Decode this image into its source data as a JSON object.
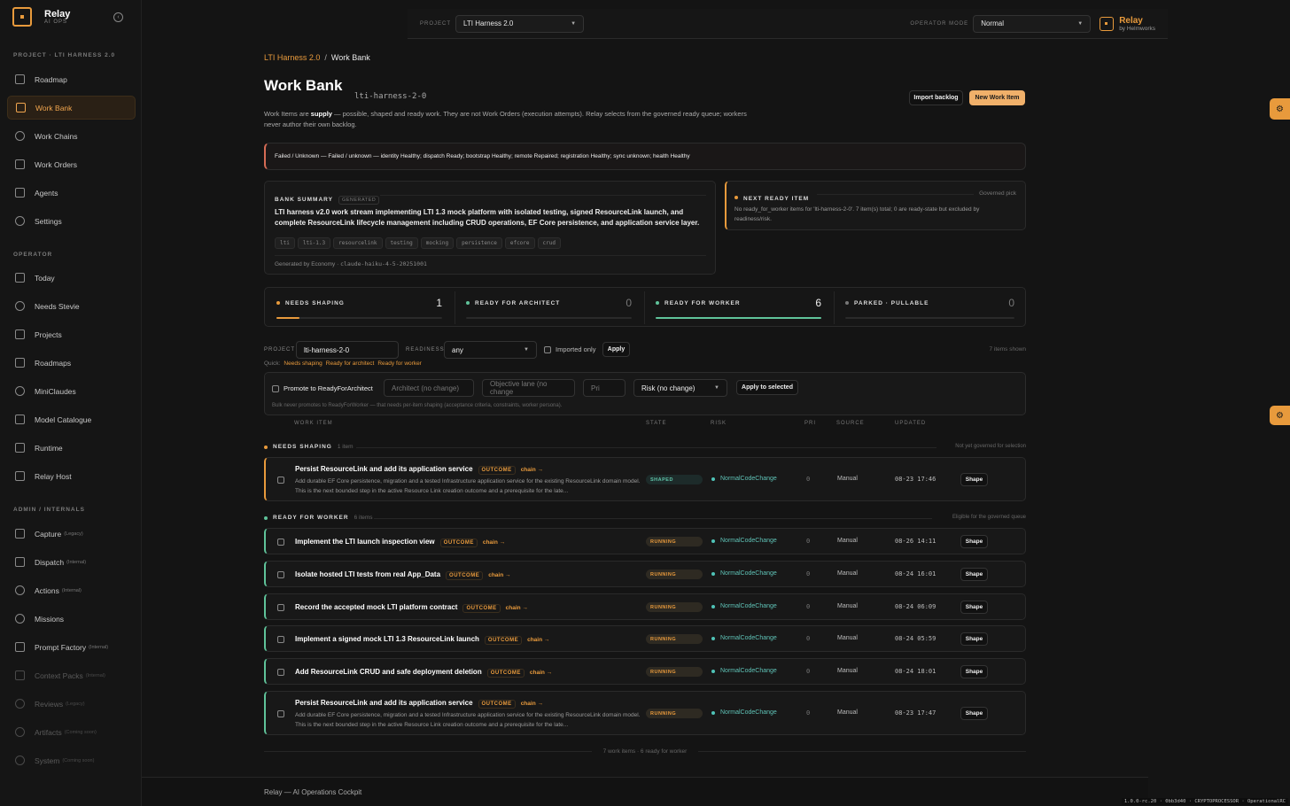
{
  "app": {
    "name": "Relay",
    "sub": "AI OPS"
  },
  "sidebar": {
    "project_section": "PROJECT · LTI HARNESS 2.0",
    "project_items": [
      {
        "label": "Roadmap"
      },
      {
        "label": "Work Bank"
      },
      {
        "label": "Work Chains"
      },
      {
        "label": "Work Orders"
      },
      {
        "label": "Agents"
      },
      {
        "label": "Settings"
      }
    ],
    "operator_section": "OPERATOR",
    "operator_items": [
      {
        "label": "Today"
      },
      {
        "label": "Needs Stevie"
      },
      {
        "label": "Projects"
      },
      {
        "label": "Roadmaps"
      },
      {
        "label": "MiniClaudes"
      },
      {
        "label": "Model Catalogue"
      },
      {
        "label": "Runtime"
      },
      {
        "label": "Relay Host"
      }
    ],
    "admin_section": "ADMIN / INTERNALS",
    "admin_items": [
      {
        "label": "Capture",
        "tag": "(Legacy)"
      },
      {
        "label": "Dispatch",
        "tag": "(Internal)"
      },
      {
        "label": "Actions",
        "tag": "(Internal)"
      },
      {
        "label": "Missions",
        "tag": ""
      },
      {
        "label": "Prompt Factory",
        "tag": "(Internal)"
      },
      {
        "label": "Context Packs",
        "tag": "(Internal)"
      },
      {
        "label": "Reviews",
        "tag": "(Legacy)"
      },
      {
        "label": "Artifacts",
        "tag": "(Coming soon)"
      },
      {
        "label": "System",
        "tag": "(Coming soon)"
      }
    ]
  },
  "topbar": {
    "project_label": "PROJECT",
    "project_value": "LTI Harness 2.0",
    "mode_label": "OPERATOR MODE",
    "mode_value": "Normal",
    "brand_name": "Relay",
    "brand_sub": "by Helmworks"
  },
  "breadcrumb": {
    "parent": "LTI Harness 2.0",
    "sep": "/",
    "current": "Work Bank"
  },
  "page": {
    "title": "Work Bank",
    "slug": "lti-harness-2-0",
    "import_label": "Import backlog",
    "new_label": "New Work Item",
    "intro_1": "Work Items are ",
    "intro_bold": "supply",
    "intro_2": " — possible, shaped and ready work. They are not Work Orders (execution attempts). Relay selects from the governed ready queue; workers never author their own backlog."
  },
  "alert": {
    "text": "Failed / Unknown — Failed / unknown — identity Healthy; dispatch Ready; bootstrap Healthy; remote Repaired; registration Healthy; sync unknown; health Healthy"
  },
  "summary": {
    "label": "BANK SUMMARY",
    "badge": "GENERATED",
    "text": "LTI harness v2.0 work stream implementing LTI 1.3 mock platform with isolated testing, signed ResourceLink launch, and complete ResourceLink lifecycle management including CRUD operations, EF Core persistence, and application service layer.",
    "tags": [
      "lti",
      "lti-1.3",
      "resourcelink",
      "testing",
      "mocking",
      "persistence",
      "efcore",
      "crud"
    ],
    "generated_by": "Generated by Economy · ",
    "model": "claude-haiku-4-5-20251001"
  },
  "next_ready": {
    "label": "NEXT READY ITEM",
    "right": "Governed pick",
    "text": "No ready_for_worker items for 'lti-harness-2-0'. 7 item(s) total; 0 are ready-state but excluded by readiness/risk."
  },
  "stats": [
    {
      "label": "NEEDS SHAPING",
      "value": "1",
      "fill": 0.14,
      "color": "#e89a3c"
    },
    {
      "label": "READY FOR ARCHITECT",
      "value": "0",
      "fill": 0,
      "color": "#5fc39a"
    },
    {
      "label": "READY FOR WORKER",
      "value": "6",
      "fill": 1.0,
      "color": "#5fc39a"
    },
    {
      "label": "PARKED · PULLABLE",
      "value": "0",
      "fill": 0,
      "color": "#777777"
    }
  ],
  "filters": {
    "project_label": "PROJECT",
    "project_value": "lti-harness-2-0",
    "readiness_label": "READINESS",
    "readiness_value": "any",
    "imported_label": "Imported only",
    "apply_label": "Apply",
    "shown": "7 items shown",
    "quick_label": "Quick:",
    "quick": [
      "Needs shaping",
      "Ready for architect",
      "Ready for worker"
    ]
  },
  "bulk": {
    "promote_label": "Promote to ReadyForArchitect",
    "architect_ph": "Architect (no change)",
    "lane_ph": "Objective lane (no change",
    "pri_ph": "Pri",
    "risk_value": "Risk (no change)",
    "apply_label": "Apply to selected",
    "note": "Bulk never promotes to ReadyForWorker — that needs per-item shaping (acceptance criteria, constraints, worker persona)."
  },
  "columns": {
    "work_item": "WORK ITEM",
    "state": "STATE",
    "risk": "RISK",
    "pri": "PRI",
    "source": "SOURCE",
    "updated": "UPDATED"
  },
  "groups": {
    "shaping": {
      "label": "NEEDS SHAPING",
      "count": "1 item",
      "right": "Not yet governed for selection"
    },
    "ready": {
      "label": "READY FOR WORKER",
      "count": "6 items",
      "right": "Eligible for the governed queue"
    }
  },
  "rows": [
    {
      "title": "Persist ResourceLink and add its application service",
      "outcome": "OUTCOME",
      "chain": "chain →",
      "desc": "Add durable EF Core persistence, migration and a tested Infrastructure application service for the existing ResourceLink domain model. This is the next bounded step in the active Resource Link creation outcome and a prerequisite for the late...",
      "state": "SHAPED",
      "risk": "NormalCodeChange",
      "pri": "0",
      "source": "Manual",
      "updated": "08-23 17:46",
      "action": "Shape"
    },
    {
      "title": "Implement the LTI launch inspection view",
      "outcome": "OUTCOME",
      "chain": "chain →",
      "desc": "",
      "state": "RUNNING",
      "risk": "NormalCodeChange",
      "pri": "0",
      "source": "Manual",
      "updated": "08-26 14:11",
      "action": "Shape"
    },
    {
      "title": "Isolate hosted LTI tests from real App_Data",
      "outcome": "OUTCOME",
      "chain": "chain →",
      "desc": "",
      "state": "RUNNING",
      "risk": "NormalCodeChange",
      "pri": "0",
      "source": "Manual",
      "updated": "08-24 16:01",
      "action": "Shape"
    },
    {
      "title": "Record the accepted mock LTI platform contract",
      "outcome": "OUTCOME",
      "chain": "chain →",
      "desc": "",
      "state": "RUNNING",
      "risk": "NormalCodeChange",
      "pri": "0",
      "source": "Manual",
      "updated": "08-24 06:09",
      "action": "Shape"
    },
    {
      "title": "Implement a signed mock LTI 1.3 ResourceLink launch",
      "outcome": "OUTCOME",
      "chain": "chain →",
      "desc": "",
      "state": "RUNNING",
      "risk": "NormalCodeChange",
      "pri": "0",
      "source": "Manual",
      "updated": "08-24 05:59",
      "action": "Shape"
    },
    {
      "title": "Add ResourceLink CRUD and safe deployment deletion",
      "outcome": "OUTCOME",
      "chain": "chain →",
      "desc": "",
      "state": "RUNNING",
      "risk": "NormalCodeChange",
      "pri": "0",
      "source": "Manual",
      "updated": "08-24 18:01",
      "action": "Shape"
    },
    {
      "title": "Persist ResourceLink and add its application service",
      "outcome": "OUTCOME",
      "chain": "chain →",
      "desc": "Add durable EF Core persistence, migration and a tested Infrastructure application service for the existing ResourceLink domain model. This is the next bounded step in the active Resource Link creation outcome and a prerequisite for the late...",
      "state": "RUNNING",
      "risk": "NormalCodeChange",
      "pri": "0",
      "source": "Manual",
      "updated": "08-23 17:47",
      "action": "Shape"
    }
  ],
  "footer": {
    "count": "7 work items · 6 ready for worker",
    "bottom": "Relay — AI Operations Cockpit",
    "version": "1.0.0-rc.20 · 0bb3d40 · CRYPTOPROCESSOR · OperationalRC"
  }
}
